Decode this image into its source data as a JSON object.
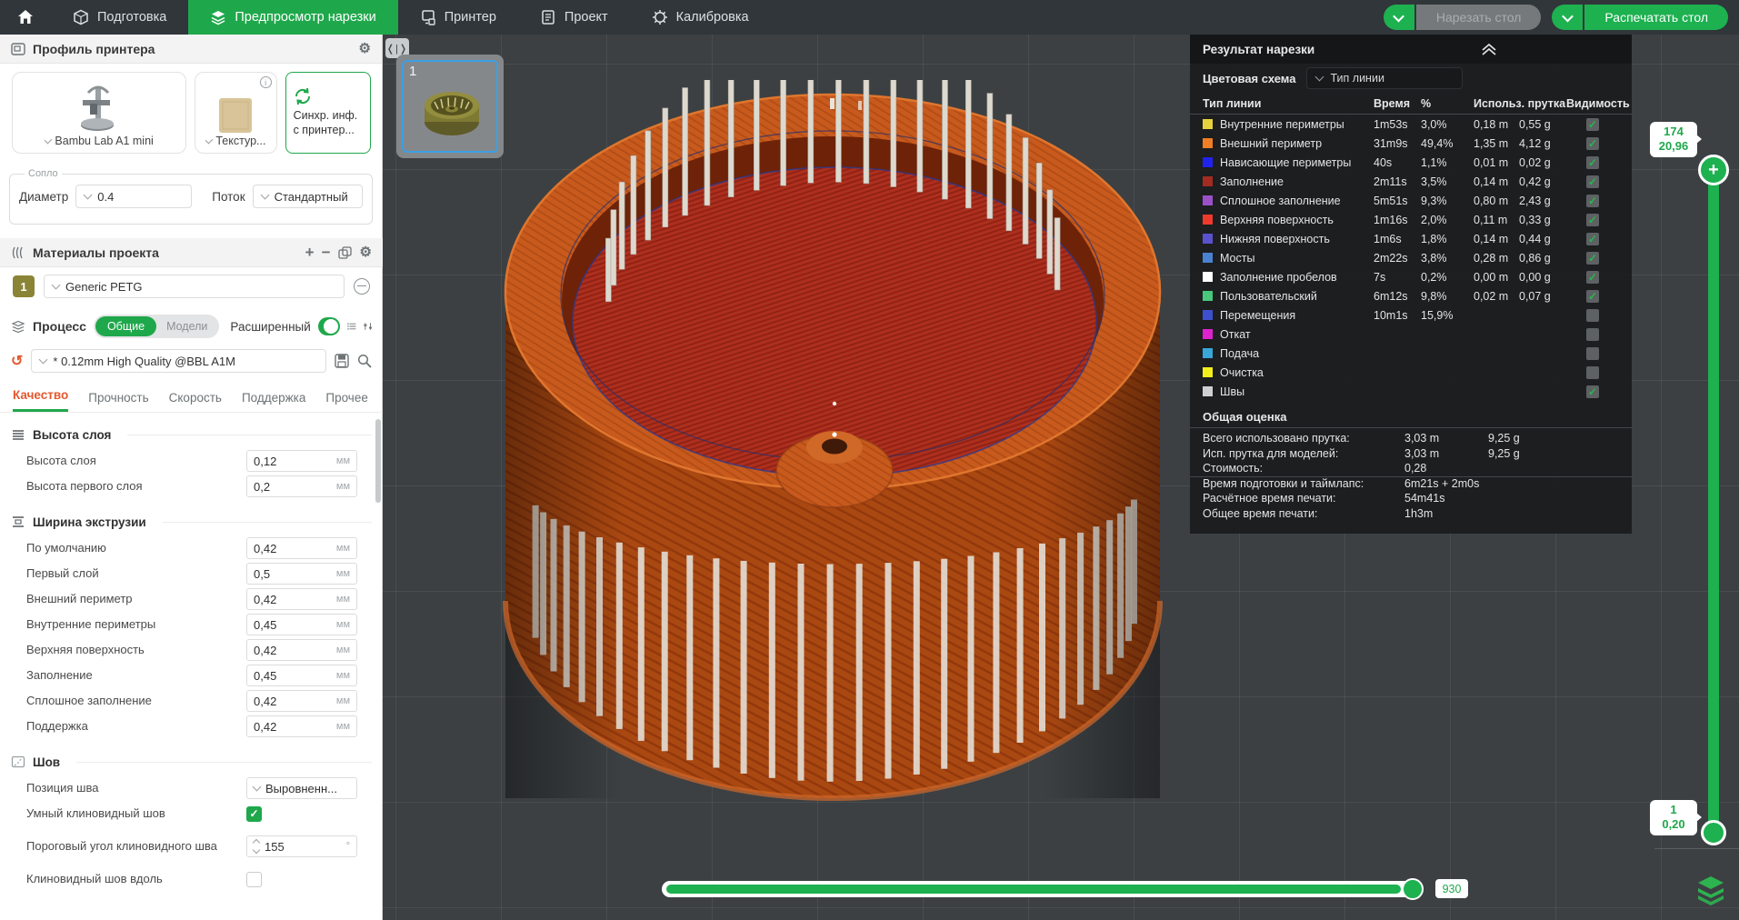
{
  "topbar": {
    "tabs": [
      {
        "label": "Подготовка",
        "active": false
      },
      {
        "label": "Предпросмотр нарезки",
        "active": true
      },
      {
        "label": "Принтер",
        "active": false
      },
      {
        "label": "Проект",
        "active": false
      },
      {
        "label": "Калибровка",
        "active": false
      }
    ],
    "slice_button": {
      "label": "Нарезать стол",
      "enabled": false
    },
    "print_button": {
      "label": "Распечатать стол",
      "enabled": true
    }
  },
  "sidebar": {
    "printer": {
      "title": "Профиль принтера",
      "name": "Bambu Lab A1 mini",
      "plate": "Текстур...",
      "sync_line1": "Синхр. инф.",
      "sync_line2": "с принтер..."
    },
    "nozzle": {
      "legend": "Сопло",
      "diameter_label": "Диаметр",
      "diameter": "0.4",
      "flow_label": "Поток",
      "flow": "Стандартный"
    },
    "filament": {
      "title": "Материалы проекта",
      "slot": "1",
      "name": "Generic PETG",
      "color": "#8a8437"
    },
    "process": {
      "title": "Процесс",
      "seg_global": "Общие",
      "seg_objects": "Модели",
      "advanced_label": "Расширенный",
      "profile": "* 0.12mm High Quality @BBL A1M"
    },
    "tabs": [
      "Качество",
      "Прочность",
      "Скорость",
      "Поддержка",
      "Прочее"
    ],
    "active_tab": "Качество",
    "groups": [
      {
        "title": "Высота слоя",
        "rows": [
          {
            "label": "Высота слоя",
            "type": "input",
            "value": "0,12",
            "unit": "мм"
          },
          {
            "label": "Высота первого слоя",
            "type": "input",
            "value": "0,2",
            "unit": "мм"
          }
        ]
      },
      {
        "title": "Ширина экструзии",
        "rows": [
          {
            "label": "По умолчанию",
            "type": "input",
            "value": "0,42",
            "unit": "мм"
          },
          {
            "label": "Первый слой",
            "type": "input",
            "value": "0,5",
            "unit": "мм"
          },
          {
            "label": "Внешний периметр",
            "type": "input",
            "value": "0,42",
            "unit": "мм"
          },
          {
            "label": "Внутренние периметры",
            "type": "input",
            "value": "0,45",
            "unit": "мм"
          },
          {
            "label": "Верхняя поверхность",
            "type": "input",
            "value": "0,42",
            "unit": "мм"
          },
          {
            "label": "Заполнение",
            "type": "input",
            "value": "0,45",
            "unit": "мм"
          },
          {
            "label": "Сплошное заполнение",
            "type": "input",
            "value": "0,42",
            "unit": "мм"
          },
          {
            "label": "Поддержка",
            "type": "input",
            "value": "0,42",
            "unit": "мм"
          }
        ]
      },
      {
        "title": "Шов",
        "rows": [
          {
            "label": "Позиция шва",
            "type": "select",
            "value": "Выровненн..."
          },
          {
            "label": "Умный клиновидный шов",
            "type": "checkbox",
            "checked": true
          },
          {
            "label": "Пороговый угол клиновидного шва",
            "type": "spinner",
            "value": "155",
            "unit": "°"
          },
          {
            "label": "Клиновидный шов вдоль",
            "type": "checkbox",
            "checked": false
          }
        ]
      }
    ]
  },
  "viewport": {
    "plate_thumb_label": "1",
    "move_slider_value": "930",
    "layer_slider": {
      "top_layer": "174",
      "top_height": "20,96",
      "bottom_layer": "1",
      "bottom_height": "0,20"
    }
  },
  "result_panel": {
    "title": "Результат нарезки",
    "color_scheme_label": "Цветовая схема",
    "color_scheme_value": "Тип линии",
    "columns": {
      "type": "Тип линии",
      "time": "Время",
      "pct": "%",
      "usage": "Использ. прутка",
      "visibility": "Видимость"
    },
    "rows": [
      {
        "color": "#e6d23c",
        "label": "Внутренние периметры",
        "time": "1m53s",
        "pct": "3,0%",
        "len": "0,18 m",
        "wt": "0,55 g",
        "visible": true
      },
      {
        "color": "#ef7e24",
        "label": "Внешний периметр",
        "time": "31m9s",
        "pct": "49,4%",
        "len": "1,35 m",
        "wt": "4,12 g",
        "visible": true
      },
      {
        "color": "#2222ee",
        "label": "Нависающие периметры",
        "time": "40s",
        "pct": "1,1%",
        "len": "0,01 m",
        "wt": "0,02 g",
        "visible": true
      },
      {
        "color": "#a42b20",
        "label": "Заполнение",
        "time": "2m11s",
        "pct": "3,5%",
        "len": "0,14 m",
        "wt": "0,42 g",
        "visible": true
      },
      {
        "color": "#9b50c8",
        "label": "Сплошное заполнение",
        "time": "5m51s",
        "pct": "9,3%",
        "len": "0,80 m",
        "wt": "2,43 g",
        "visible": true
      },
      {
        "color": "#ee3a2c",
        "label": "Верхняя поверхность",
        "time": "1m16s",
        "pct": "2,0%",
        "len": "0,11 m",
        "wt": "0,33 g",
        "visible": true
      },
      {
        "color": "#5a52cc",
        "label": "Нижняя поверхность",
        "time": "1m6s",
        "pct": "1,8%",
        "len": "0,14 m",
        "wt": "0,44 g",
        "visible": true
      },
      {
        "color": "#4a82d2",
        "label": "Мосты",
        "time": "2m22s",
        "pct": "3,8%",
        "len": "0,28 m",
        "wt": "0,86 g",
        "visible": true
      },
      {
        "color": "#ffffff",
        "label": "Заполнение пробелов",
        "time": "7s",
        "pct": "0,2%",
        "len": "0,00 m",
        "wt": "0,00 g",
        "visible": true
      },
      {
        "color": "#48c87d",
        "label": "Пользовательский",
        "time": "6m12s",
        "pct": "9,8%",
        "len": "0,02 m",
        "wt": "0,07 g",
        "visible": true
      },
      {
        "color": "#3c50d0",
        "label": "Перемещения",
        "time": "10m1s",
        "pct": "15,9%",
        "len": "",
        "wt": "",
        "visible": false
      },
      {
        "color": "#de22ce",
        "label": "Откат",
        "time": "",
        "pct": "",
        "len": "",
        "wt": "",
        "visible": false
      },
      {
        "color": "#38a8d8",
        "label": "Подача",
        "time": "",
        "pct": "",
        "len": "",
        "wt": "",
        "visible": false
      },
      {
        "color": "#f2ee1c",
        "label": "Очистка",
        "time": "",
        "pct": "",
        "len": "",
        "wt": "",
        "visible": false
      },
      {
        "color": "#d0d0d0",
        "label": "Швы",
        "time": "",
        "pct": "",
        "len": "",
        "wt": "",
        "visible": true
      }
    ],
    "summary_title": "Общая оценка",
    "summary": [
      {
        "label": "Всего использовано прутка:",
        "v1": "3,03 m",
        "v2": "9,25 g",
        "divided": false
      },
      {
        "label": "Исп. прутка для моделей:",
        "v1": "3,03 m",
        "v2": "9,25 g",
        "divided": false
      },
      {
        "label": "Стоимость:",
        "v1": "0,28",
        "v2": "",
        "divided": false
      },
      {
        "label": "Время подготовки и таймлапс:",
        "v1": "6m21s + 2m0s",
        "v2": "",
        "divided": true
      },
      {
        "label": "Расчётное время печати:",
        "v1": "54m41s",
        "v2": "",
        "divided": false
      },
      {
        "label": "Общее время печати:",
        "v1": "1h3m",
        "v2": "",
        "divided": false
      }
    ]
  },
  "colors": {
    "accent_green": "#1fa84b",
    "bright_green": "#1db150",
    "quality_tab_orange": "#e4572e",
    "model_orange": "#c85a1e",
    "model_floor_red": "#ad2f1e",
    "filament_swatch": "#8a8437"
  }
}
